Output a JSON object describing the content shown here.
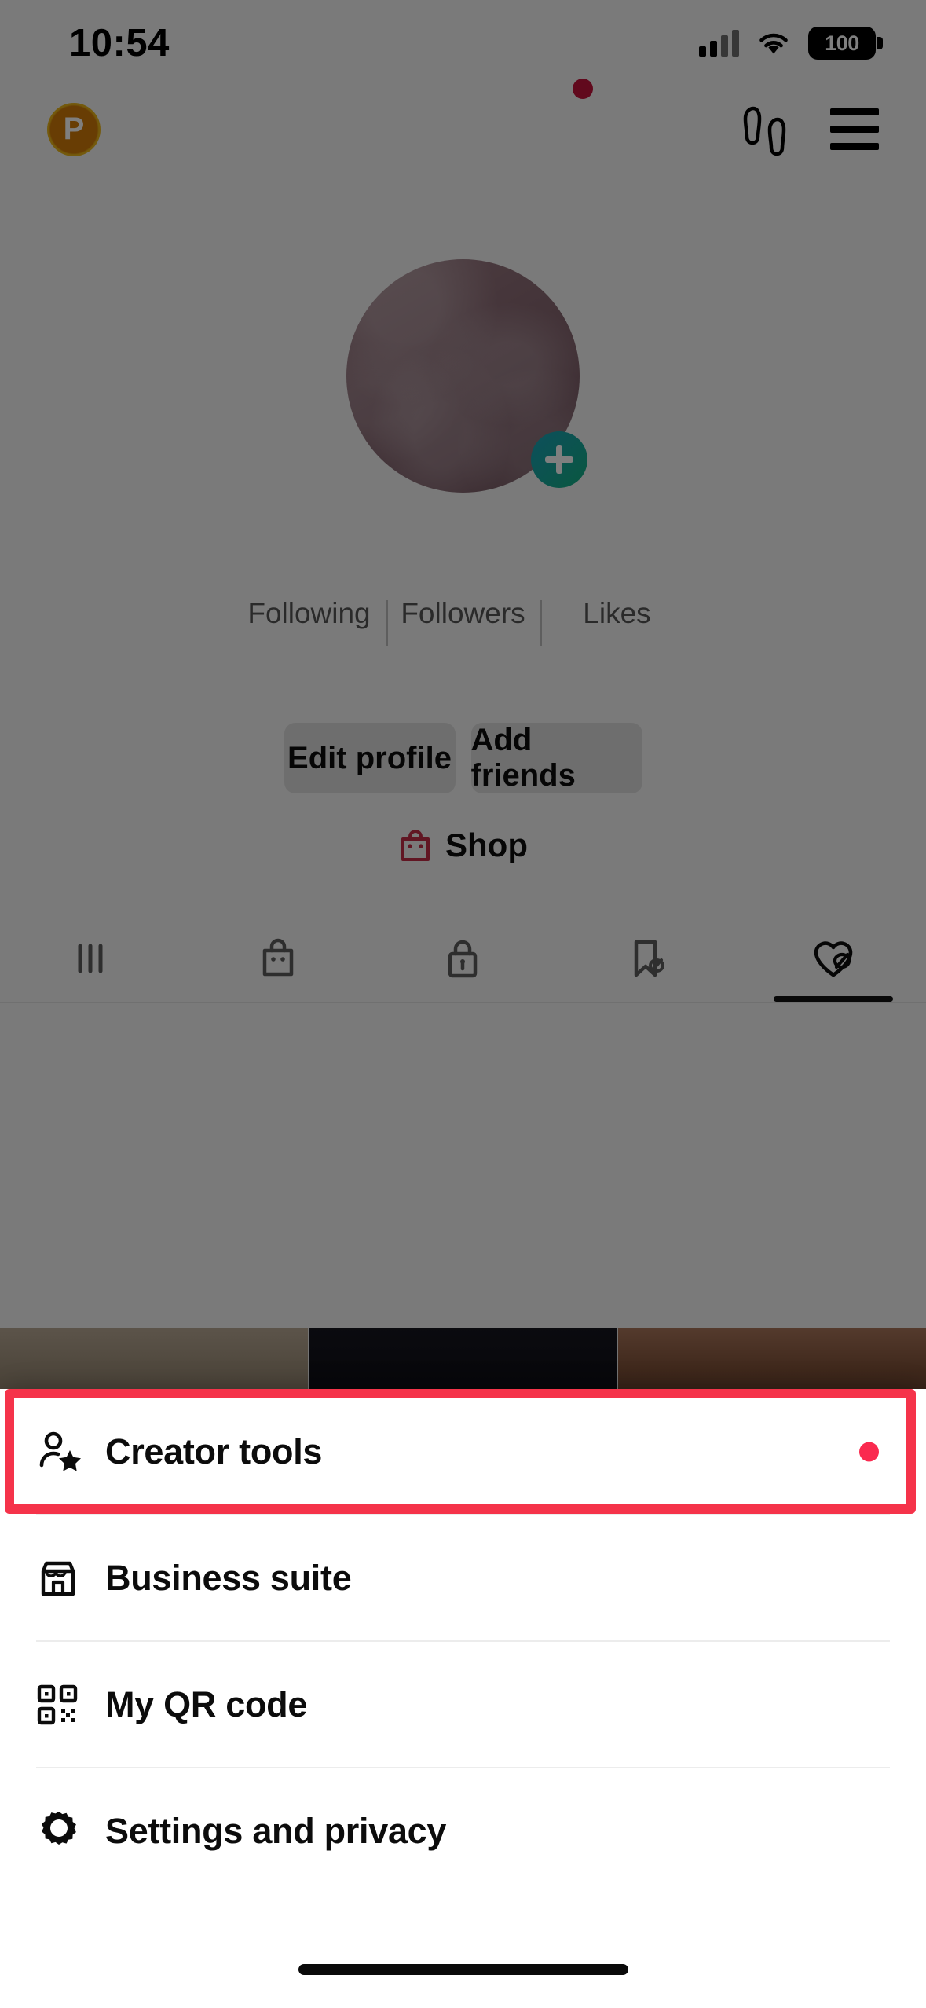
{
  "status_bar": {
    "time": "10:54",
    "signal_icon": "cellular-signal-icon",
    "wifi_icon": "wifi-icon",
    "battery_level": "100",
    "battery_icon": "battery-full-icon"
  },
  "top_nav": {
    "coin_badge_letter": "P",
    "coin_badge_icon": "points-coin-icon",
    "notification_dot": true,
    "footprints_icon": "footprints-icon",
    "menu_icon": "hamburger-menu-icon"
  },
  "profile": {
    "avatar_icon": "profile-avatar",
    "add_story_icon": "plus-icon",
    "stats": [
      {
        "count": "",
        "label": "Following"
      },
      {
        "count": "",
        "label": "Followers"
      },
      {
        "count": "",
        "label": "Likes"
      }
    ],
    "buttons": {
      "edit_profile": "Edit profile",
      "add_friends": "Add friends"
    },
    "shop": {
      "label": "Shop",
      "icon": "shopping-bag-icon",
      "color": "#c22c46"
    }
  },
  "content_tabs": [
    {
      "name": "posts-tab",
      "icon": "grid-posts-icon",
      "active": false
    },
    {
      "name": "shop-tab",
      "icon": "shopping-bag-icon",
      "active": false
    },
    {
      "name": "private-tab",
      "icon": "lock-icon",
      "active": false
    },
    {
      "name": "saved-tab",
      "icon": "bookmark-hidden-icon",
      "active": false
    },
    {
      "name": "liked-tab",
      "icon": "heart-hidden-icon",
      "active": true
    }
  ],
  "bottom_sheet": {
    "highlight_color": "#f5334a",
    "items": [
      {
        "label": "Creator tools",
        "icon": "person-star-icon",
        "badge": true,
        "highlighted": true
      },
      {
        "label": "Business suite",
        "icon": "storefront-icon",
        "badge": false,
        "highlighted": false
      },
      {
        "label": "My QR code",
        "icon": "qr-code-icon",
        "badge": false,
        "highlighted": false
      },
      {
        "label": "Settings and privacy",
        "icon": "gear-icon",
        "badge": false,
        "highlighted": false
      }
    ]
  },
  "home_indicator": "home-indicator"
}
